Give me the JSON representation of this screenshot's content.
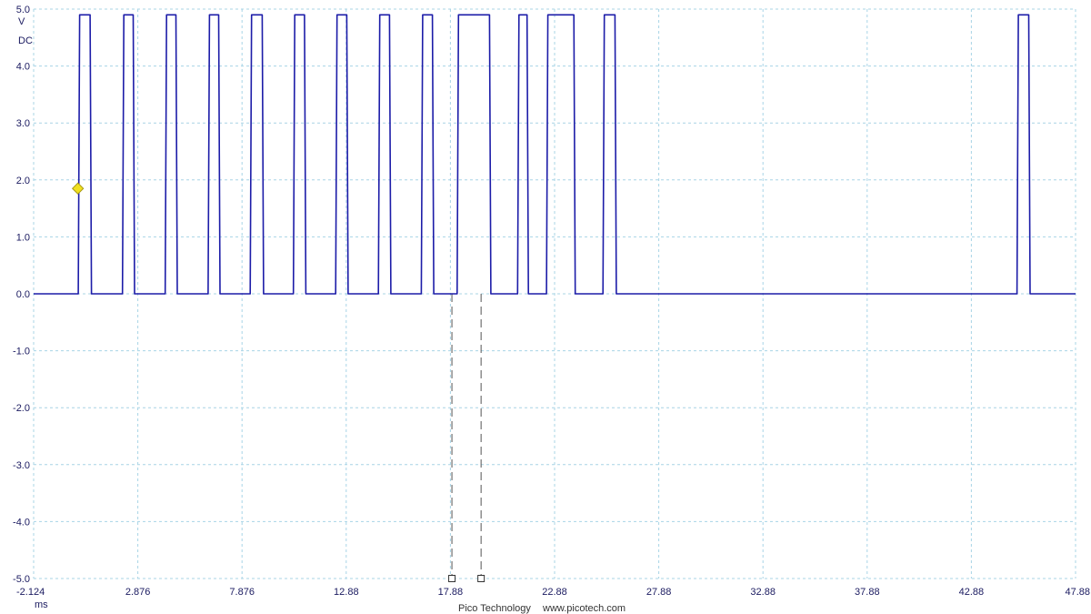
{
  "chart_data": {
    "type": "line",
    "y_unit": "V",
    "y_coupling": "DC",
    "x_unit": "ms",
    "footer_brand": "Pico Technology",
    "footer_url": "www.picotech.com",
    "xlim": [
      -2.124,
      47.88
    ],
    "ylim": [
      -5.0,
      5.0
    ],
    "x_ticks": [
      "-2.124",
      "2.876",
      "7.876",
      "12.88",
      "17.88",
      "22.88",
      "27.88",
      "32.88",
      "37.88",
      "42.88",
      "47.88"
    ],
    "y_ticks": [
      "5.0",
      "4.0",
      "3.0",
      "2.0",
      "1.0",
      "0.0",
      "-1.0",
      "-2.0",
      "-3.0",
      "-4.0",
      "-5.0"
    ],
    "grid": true,
    "series": [
      {
        "color": "#1c1ca8",
        "high": 4.9,
        "low": 0.0,
        "pulses": [
          [
            0.02,
            0.65
          ],
          [
            2.14,
            2.72
          ],
          [
            4.19,
            4.77
          ],
          [
            6.25,
            6.82
          ],
          [
            8.27,
            8.91
          ],
          [
            10.34,
            10.94
          ],
          [
            12.37,
            12.97
          ],
          [
            14.42,
            15.02
          ],
          [
            16.48,
            17.08
          ],
          [
            18.2,
            19.82
          ],
          [
            21.1,
            21.62
          ],
          [
            22.49,
            23.87
          ],
          [
            25.2,
            25.84
          ],
          [
            45.07,
            45.7
          ]
        ]
      }
    ],
    "trigger_marker": {
      "time": 0.0,
      "value": 1.85,
      "color": "#f0e020"
    },
    "cursors": [
      17.95,
      19.35
    ]
  }
}
